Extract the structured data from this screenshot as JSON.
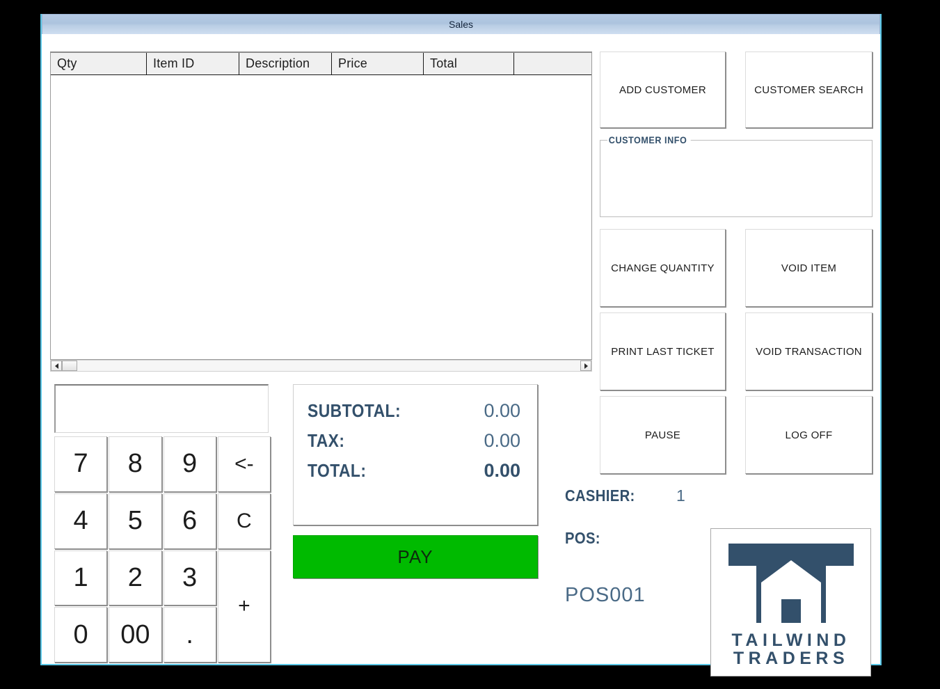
{
  "window": {
    "title": "Sales"
  },
  "grid": {
    "columns": [
      "Qty",
      "Item ID",
      "Description",
      "Price",
      "Total",
      ""
    ],
    "rows": []
  },
  "scrollbar": {
    "left_arrow_icon": "triangle-left-icon",
    "right_arrow_icon": "triangle-right-icon"
  },
  "keypad": {
    "display_value": "",
    "keys": [
      {
        "label": "7",
        "name": "key-7"
      },
      {
        "label": "8",
        "name": "key-8"
      },
      {
        "label": "9",
        "name": "key-9"
      },
      {
        "label": "<-",
        "name": "key-backspace"
      },
      {
        "label": "4",
        "name": "key-4"
      },
      {
        "label": "5",
        "name": "key-5"
      },
      {
        "label": "6",
        "name": "key-6"
      },
      {
        "label": "C",
        "name": "key-clear"
      },
      {
        "label": "1",
        "name": "key-1"
      },
      {
        "label": "2",
        "name": "key-2"
      },
      {
        "label": "3",
        "name": "key-3"
      },
      {
        "label": "+",
        "name": "key-plus"
      },
      {
        "label": "0",
        "name": "key-0"
      },
      {
        "label": "00",
        "name": "key-double-zero"
      },
      {
        "label": ".",
        "name": "key-decimal"
      }
    ]
  },
  "totals": {
    "subtotal_label": "SUBTOTAL:",
    "subtotal_value": "0.00",
    "tax_label": "TAX:",
    "tax_value": "0.00",
    "total_label": "TOTAL:",
    "total_value": "0.00"
  },
  "pay": {
    "label": "PAY"
  },
  "actions": {
    "add_customer": "ADD CUSTOMER",
    "customer_search": "CUSTOMER SEARCH",
    "change_quantity": "CHANGE QUANTITY",
    "void_item": "VOID ITEM",
    "print_last_ticket": "PRINT LAST TICKET",
    "void_transaction": "VOID TRANSACTION",
    "pause": "PAUSE",
    "log_off": "LOG OFF"
  },
  "customer_info": {
    "legend": "CUSTOMER INFO",
    "content": ""
  },
  "session": {
    "cashier_label": "CASHIER:",
    "cashier_value": "1",
    "pos_label": "POS:",
    "pos_value": "POS001"
  },
  "brand": {
    "name_line1": "TAILWIND",
    "name_line2": "TRADERS",
    "navy": "#33506b"
  },
  "colors": {
    "accent_green": "#00ba00",
    "brand_navy": "#33506b",
    "title_bar_blue": "#b1c6e0",
    "window_border": "#5bc8e8"
  }
}
